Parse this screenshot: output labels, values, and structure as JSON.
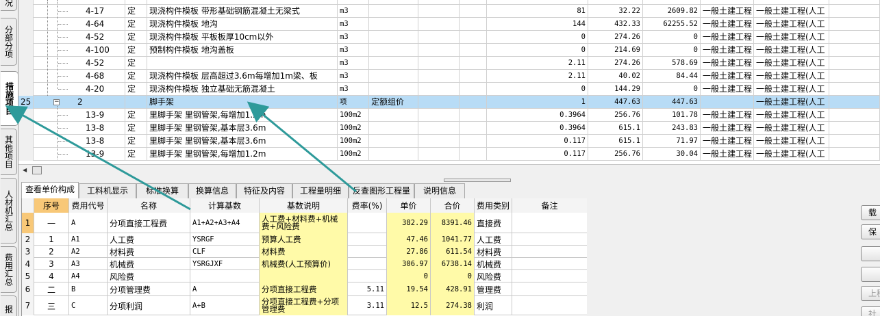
{
  "side_tabs": [
    {
      "label": "况",
      "active": false
    },
    {
      "label": "分部分项",
      "active": false
    },
    {
      "label": "措施项目",
      "active": true
    },
    {
      "label": "其他项目",
      "active": false
    },
    {
      "label": "人材机汇总",
      "active": false
    },
    {
      "label": "费用汇总",
      "active": false
    },
    {
      "label": "报",
      "active": false
    }
  ],
  "upper_rows": [
    {
      "no": "",
      "code": "4-17",
      "type": "定",
      "name": "现浇构件模板 带形基础钢筋混凝土无梁式",
      "unit": "m3",
      "desc": "",
      "qty": "81",
      "price": "32.22",
      "total": "2609.82",
      "cat1": "一般土建工程",
      "cat2": "一般土建工程(人工"
    },
    {
      "no": "",
      "code": "4-64",
      "type": "定",
      "name": "现浇构件模板 地沟",
      "unit": "m3",
      "desc": "",
      "qty": "144",
      "price": "432.33",
      "total": "62255.52",
      "cat1": "一般土建工程",
      "cat2": "一般土建工程(人工"
    },
    {
      "no": "",
      "code": "4-52",
      "type": "定",
      "name": "现浇构件模板 平板板厚10cm以外",
      "unit": "m3",
      "desc": "",
      "qty": "0",
      "price": "274.26",
      "total": "0",
      "cat1": "一般土建工程",
      "cat2": "一般土建工程(人工"
    },
    {
      "no": "",
      "code": "4-100",
      "type": "定",
      "name": "预制构件模板 地沟盖板",
      "unit": "m3",
      "desc": "",
      "qty": "0",
      "price": "214.69",
      "total": "0",
      "cat1": "一般土建工程",
      "cat2": "一般土建工程(人工"
    },
    {
      "no": "",
      "code": "4-52",
      "type": "定",
      "name": "",
      "unit": "m3",
      "desc": "",
      "qty": "2.11",
      "price": "274.26",
      "total": "578.69",
      "cat1": "一般土建工程",
      "cat2": "一般土建工程(人工"
    },
    {
      "no": "",
      "code": "4-68",
      "type": "定",
      "name": "现浇构件模板 层高超过3.6m每增加1m梁、板",
      "unit": "m3",
      "desc": "",
      "qty": "2.11",
      "price": "40.02",
      "total": "84.44",
      "cat1": "一般土建工程",
      "cat2": "一般土建工程(人工"
    },
    {
      "no": "",
      "code": "4-20",
      "type": "定",
      "name": "现浇构件模板 独立基础无筋混凝土",
      "unit": "m3",
      "desc": "",
      "qty": "0",
      "price": "144.29",
      "total": "0",
      "cat1": "一般土建工程",
      "cat2": "一般土建工程(人工"
    },
    {
      "no": "25",
      "code": "2",
      "type": "",
      "name": "脚手架",
      "unit": "项",
      "desc": "定额组价",
      "qty": "1",
      "price": "447.63",
      "total": "447.63",
      "cat1": "",
      "cat2": "一般土建工程(人工"
    },
    {
      "no": "",
      "code": "13-9",
      "type": "定",
      "name": "里脚手架 里钢管架,每增加1.2m",
      "unit": "100m2",
      "desc": "",
      "qty": "0.3964",
      "price": "256.76",
      "total": "101.78",
      "cat1": "一般土建工程",
      "cat2": "一般土建工程(人工"
    },
    {
      "no": "",
      "code": "13-8",
      "type": "定",
      "name": "里脚手架 里钢管架,基本层3.6m",
      "unit": "100m2",
      "desc": "",
      "qty": "0.3964",
      "price": "615.1",
      "total": "243.83",
      "cat1": "一般土建工程",
      "cat2": "一般土建工程(人工"
    },
    {
      "no": "",
      "code": "13-8",
      "type": "定",
      "name": "里脚手架 里钢管架,基本层3.6m",
      "unit": "100m2",
      "desc": "",
      "qty": "0.117",
      "price": "615.1",
      "total": "71.97",
      "cat1": "一般土建工程",
      "cat2": "一般土建工程(人工"
    },
    {
      "no": "",
      "code": "13-9",
      "type": "定",
      "name": "里脚手架 里钢管架,每增加1.2m",
      "unit": "100m2",
      "desc": "",
      "qty": "0.117",
      "price": "256.76",
      "total": "30.04",
      "cat1": "一般土建工程",
      "cat2": "一般土建工程(人工"
    }
  ],
  "tabs": [
    "查看单价构成",
    "工料机显示",
    "标准换算",
    "换算信息",
    "特征及内容",
    "工程量明细",
    "反查图形工程量",
    "说明信息"
  ],
  "lower_headers": [
    "序号",
    "费用代号",
    "名称",
    "计算基数",
    "基数说明",
    "费率(%)",
    "单价",
    "合价",
    "费用类别",
    "备注"
  ],
  "lower_rows": [
    {
      "row": "1",
      "seq": "一",
      "code": "A",
      "name": "分项直接工程费",
      "base": "A1+A2+A3+A4",
      "base_desc": "人工费+材料费+机械费+风险费",
      "rate": "",
      "price": "382.29",
      "total": "8391.46",
      "cat": "直接费",
      "note": ""
    },
    {
      "row": "2",
      "seq": "1",
      "code": "A1",
      "name": "人工费",
      "base": "YSRGF",
      "base_desc": "预算人工费",
      "rate": "",
      "price": "47.46",
      "total": "1041.77",
      "cat": "人工费",
      "note": ""
    },
    {
      "row": "3",
      "seq": "2",
      "code": "A2",
      "name": "材料费",
      "base": "CLF",
      "base_desc": "材料费",
      "rate": "",
      "price": "27.86",
      "total": "611.54",
      "cat": "材料费",
      "note": ""
    },
    {
      "row": "4",
      "seq": "3",
      "code": "A3",
      "name": "机械费",
      "base": "YSRGJXF",
      "base_desc": "机械费(人工预算价)",
      "rate": "",
      "price": "306.97",
      "total": "6738.14",
      "cat": "机械费",
      "note": ""
    },
    {
      "row": "5",
      "seq": "4",
      "code": "A4",
      "name": "风险费",
      "base": "",
      "base_desc": "",
      "rate": "",
      "price": "0",
      "total": "0",
      "cat": "风险费",
      "note": ""
    },
    {
      "row": "6",
      "seq": "二",
      "code": "B",
      "name": "分项管理费",
      "base": "A",
      "base_desc": "分项直接工程费",
      "rate": "5.11",
      "price": "19.54",
      "total": "428.91",
      "cat": "管理费",
      "note": ""
    },
    {
      "row": "7",
      "seq": "三",
      "code": "C",
      "name": "分项利润",
      "base": "A+B",
      "base_desc": "分项直接工程费+分项管理费",
      "rate": "3.11",
      "price": "12.5",
      "total": "274.38",
      "cat": "利润",
      "note": ""
    }
  ],
  "right_buttons": [
    "载",
    "保",
    "",
    "",
    "上移",
    "社"
  ],
  "colors": {
    "selected_row": "#b8dcf6",
    "highlight_yellow": "#fffaa8",
    "header_orange": "#f8c878",
    "arrow_teal": "#2e9a9a"
  }
}
